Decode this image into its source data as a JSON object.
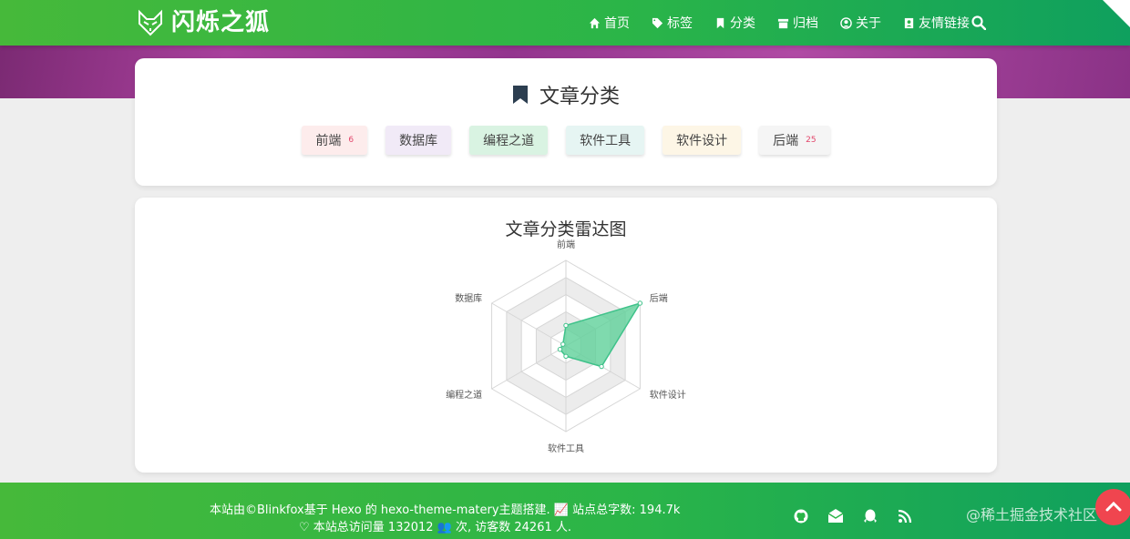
{
  "header": {
    "brand": "闪烁之狐",
    "nav": [
      {
        "label": "首页",
        "icon": "home-icon"
      },
      {
        "label": "标签",
        "icon": "tags-icon"
      },
      {
        "label": "分类",
        "icon": "bookmark-icon"
      },
      {
        "label": "归档",
        "icon": "archive-icon"
      },
      {
        "label": "关于",
        "icon": "user-circle-icon"
      },
      {
        "label": "友情链接",
        "icon": "address-book-icon"
      }
    ]
  },
  "categories": {
    "title": "文章分类",
    "items": [
      {
        "label": "前端",
        "count": "6",
        "color": "#fdecec"
      },
      {
        "label": "数据库",
        "count": "",
        "color": "#f1eaf7"
      },
      {
        "label": "编程之道",
        "count": "",
        "color": "#d9f3e2"
      },
      {
        "label": "软件工具",
        "count": "",
        "color": "#e6f5f3"
      },
      {
        "label": "软件设计",
        "count": "",
        "color": "#fdf6e6"
      },
      {
        "label": "后端",
        "count": "25",
        "color": "#f5f5f5"
      }
    ]
  },
  "radar": {
    "title": "文章分类雷达图",
    "chart_data": {
      "type": "radar",
      "title": "文章分类雷达图",
      "indicators": [
        "前端",
        "后端",
        "软件设计",
        "软件工具",
        "编程之道",
        "数据库"
      ],
      "max": 25,
      "values": [
        6,
        25,
        12,
        3,
        2,
        1
      ],
      "fill_color": "#5fd19a",
      "stroke_color": "#3fc28a"
    }
  },
  "footer": {
    "line1": "本站由©Blinkfox基于 Hexo 的 hexo-theme-matery主题搭建.  📈 站点总字数:  194.7k",
    "line2": "♡ 本站总访问量 132012 👥 次, 访客数 24261 人.",
    "watermark": "@稀土掘金技术社区"
  }
}
